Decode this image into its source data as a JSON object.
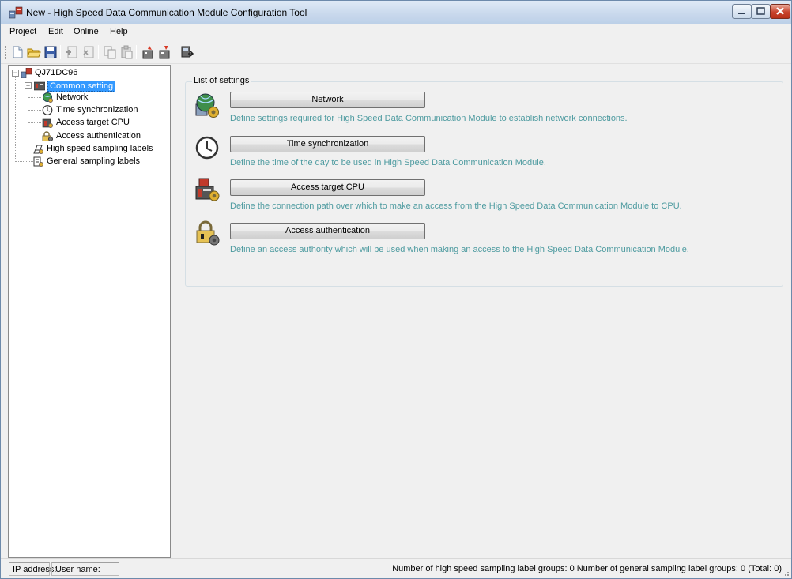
{
  "window": {
    "title": "New - High Speed Data Communication Module Configuration Tool"
  },
  "menu": [
    "Project",
    "Edit",
    "Online",
    "Help"
  ],
  "toolbar_icons": [
    "new-file-icon",
    "open-folder-icon",
    "save-icon",
    "add-item-icon",
    "remove-item-icon",
    "copy-icon",
    "paste-icon",
    "write-to-module-icon",
    "read-from-module-icon",
    "online-monitor-icon"
  ],
  "tree": {
    "root": "QJ71DC96",
    "common": "Common setting",
    "children": [
      "Network",
      "Time synchronization",
      "Access target CPU",
      "Access authentication"
    ],
    "high_speed": "High speed sampling labels",
    "general": "General sampling labels"
  },
  "settings": {
    "group_label": "List of settings",
    "items": [
      {
        "label": "Network",
        "desc": "Define settings required for High Speed Data Communication Module to establish network connections.",
        "icon": "network-globe-icon"
      },
      {
        "label": "Time synchronization",
        "desc": "Define the time of the day to be used in High Speed Data Communication Module.",
        "icon": "clock-icon"
      },
      {
        "label": "Access target CPU",
        "desc": "Define the connection path over which to make an access from the High Speed Data Communication Module to CPU.",
        "icon": "cpu-module-icon"
      },
      {
        "label": "Access authentication",
        "desc": "Define an access authority which will be used when making an access to the High Speed Data Communication Module.",
        "icon": "lock-icon"
      }
    ]
  },
  "status": {
    "ip": "IP address:",
    "user": "User name:",
    "summary": "Number of high speed sampling label groups: 0   Number of general sampling label groups: 0   (Total: 0)"
  },
  "colors": {
    "selection": "#3399ff",
    "description_text": "#4e9ba0",
    "close_button": "#c8432c"
  }
}
